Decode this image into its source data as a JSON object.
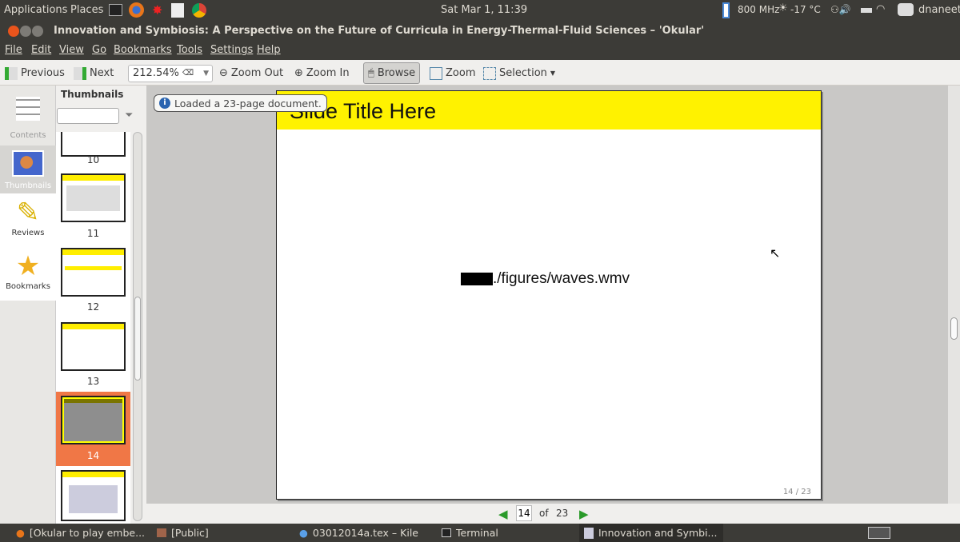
{
  "top_panel": {
    "applications": "Applications",
    "places": "Places",
    "clock": "Sat Mar  1, 11:39",
    "cpu": "800 MHz",
    "weather": "-17 °C",
    "user": "dnaneet"
  },
  "window": {
    "title": "Innovation and Symbiosis: A Perspective on the Future of Curricula in Energy-Thermal-Fluid Sciences – 'Okular'"
  },
  "menu": [
    "File",
    "Edit",
    "View",
    "Go",
    "Bookmarks",
    "Tools",
    "Settings",
    "Help"
  ],
  "toolbar": {
    "previous": "Previous",
    "next": "Next",
    "zoom_value": "212.54%",
    "zoom_out": "Zoom Out",
    "zoom_in": "Zoom In",
    "browse": "Browse",
    "zoom": "Zoom",
    "selection": "Selection"
  },
  "sidebar": {
    "items": [
      {
        "label": "Contents",
        "icon": "contents-icon"
      },
      {
        "label": "Thumbnails",
        "icon": "balloon-icon",
        "active": true
      },
      {
        "label": "Reviews",
        "icon": "pencil-icon"
      },
      {
        "label": "Bookmarks",
        "icon": "star-icon"
      }
    ]
  },
  "thumbnails": {
    "title": "Thumbnails",
    "search_value": "",
    "pages": [
      "10",
      "11",
      "12",
      "13",
      "14"
    ],
    "selected": "14",
    "accent": "#f07746"
  },
  "notice": "Loaded a 23-page document.",
  "slide": {
    "title": "Slide Title Here",
    "media": "./figures/waves.wmv",
    "page_label": "14 / 23",
    "title_color": "#fff200"
  },
  "page_nav": {
    "current": "14",
    "of": "of",
    "total": "23"
  },
  "taskbar": [
    "[Okular to play embe...",
    "[Public]",
    "03012014a.tex – Kile",
    "Terminal",
    "Innovation and Symbi..."
  ]
}
